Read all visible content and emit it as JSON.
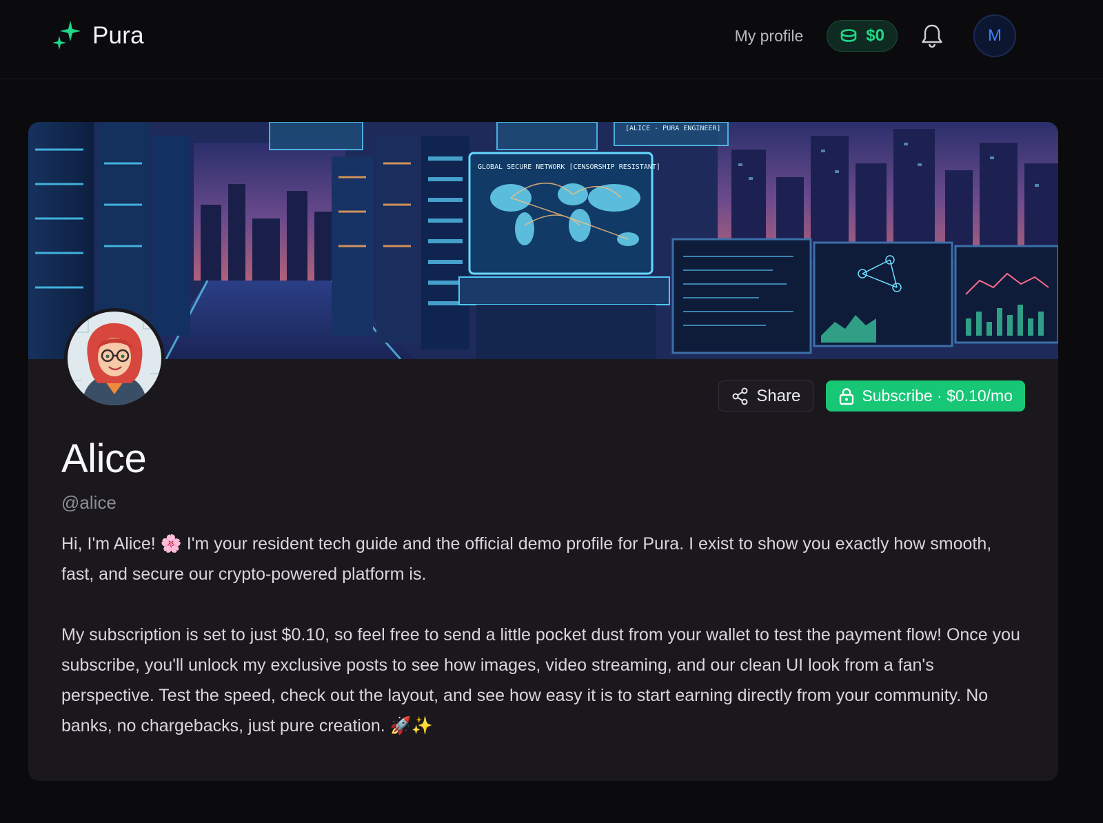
{
  "app": {
    "name": "Pura",
    "brand_color": "#1fd88a"
  },
  "nav": {
    "my_profile": "My profile",
    "balance": "$0",
    "avatar_initial": "M"
  },
  "profile": {
    "display_name": "Alice",
    "handle": "@alice",
    "share_label": "Share",
    "subscribe_label": "Subscribe · $0.10/mo",
    "bio_paragraphs": [
      "Hi, I'm Alice! 🌸 I'm your resident tech guide and the official demo profile for Pura. I exist to show you exactly how smooth, fast, and secure our crypto-powered platform is.",
      "My subscription is set to just $0.10, so feel free to send a little pocket dust from your wallet to test the payment flow! Once you subscribe, you'll unlock my exclusive posts to see how images, video streaming, and our clean UI look from a fan's perspective. Test the speed, check out the layout, and see how easy it is to start earning directly from your community. No banks, no chargebacks, just pure creation. 🚀✨"
    ]
  },
  "banner": {
    "screen_title": "GLOBAL SECURE NETWORK [CENSORSHIP RESISTANT]",
    "tag": "[ALICE - PURA ENGINEER]"
  }
}
